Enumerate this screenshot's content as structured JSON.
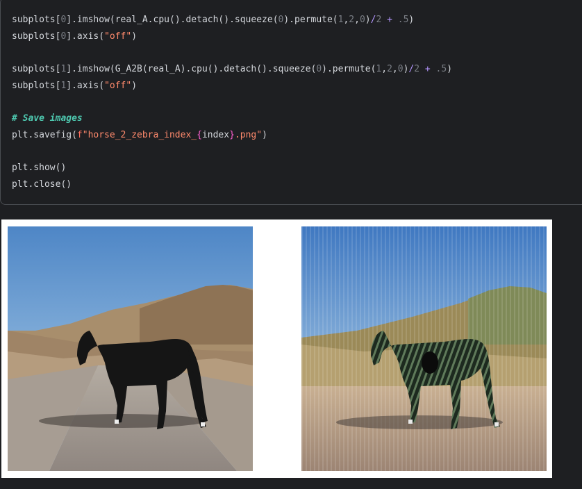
{
  "code": {
    "lines": [
      [
        {
          "t": "subplots[",
          "c": ""
        },
        {
          "t": "0",
          "c": "num"
        },
        {
          "t": "].imshow(real_A.cpu().detach().squeeze(",
          "c": ""
        },
        {
          "t": "0",
          "c": "num"
        },
        {
          "t": ").permute(",
          "c": ""
        },
        {
          "t": "1",
          "c": "num"
        },
        {
          "t": ",",
          "c": ""
        },
        {
          "t": "2",
          "c": "num"
        },
        {
          "t": ",",
          "c": ""
        },
        {
          "t": "0",
          "c": "num"
        },
        {
          "t": ")",
          "c": ""
        },
        {
          "t": "/",
          "c": "op"
        },
        {
          "t": "2",
          "c": "num"
        },
        {
          "t": " ",
          "c": ""
        },
        {
          "t": "+",
          "c": "op"
        },
        {
          "t": " ",
          "c": ""
        },
        {
          "t": ".5",
          "c": "num"
        },
        {
          "t": ")",
          "c": ""
        }
      ],
      [
        {
          "t": "subplots[",
          "c": ""
        },
        {
          "t": "0",
          "c": "num"
        },
        {
          "t": "].axis(",
          "c": ""
        },
        {
          "t": "\"off\"",
          "c": "str"
        },
        {
          "t": ")",
          "c": ""
        }
      ],
      [],
      [
        {
          "t": "subplots[",
          "c": ""
        },
        {
          "t": "1",
          "c": "num"
        },
        {
          "t": "].imshow(G_A2B(real_A).cpu().detach().squeeze(",
          "c": ""
        },
        {
          "t": "0",
          "c": "num"
        },
        {
          "t": ").permute(",
          "c": ""
        },
        {
          "t": "1",
          "c": "num"
        },
        {
          "t": ",",
          "c": ""
        },
        {
          "t": "2",
          "c": "num"
        },
        {
          "t": ",",
          "c": ""
        },
        {
          "t": "0",
          "c": "num"
        },
        {
          "t": ")",
          "c": ""
        },
        {
          "t": "/",
          "c": "op"
        },
        {
          "t": "2",
          "c": "num"
        },
        {
          "t": " ",
          "c": ""
        },
        {
          "t": "+",
          "c": "op"
        },
        {
          "t": " ",
          "c": ""
        },
        {
          "t": ".5",
          "c": "num"
        },
        {
          "t": ")",
          "c": ""
        }
      ],
      [
        {
          "t": "subplots[",
          "c": ""
        },
        {
          "t": "1",
          "c": "num"
        },
        {
          "t": "].axis(",
          "c": ""
        },
        {
          "t": "\"off\"",
          "c": "str"
        },
        {
          "t": ")",
          "c": ""
        }
      ],
      [],
      [
        {
          "t": "# Save images",
          "c": "cm"
        }
      ],
      [
        {
          "t": "plt.savefig(",
          "c": ""
        },
        {
          "t": "f",
          "c": "fpre"
        },
        {
          "t": "\"horse_2_zebra_index_",
          "c": "str"
        },
        {
          "t": "{",
          "c": "brace"
        },
        {
          "t": "index",
          "c": ""
        },
        {
          "t": "}",
          "c": "brace"
        },
        {
          "t": ".png\"",
          "c": "str"
        },
        {
          "t": ")",
          "c": ""
        }
      ],
      [],
      [
        {
          "t": "plt.show()",
          "c": ""
        }
      ],
      [
        {
          "t": "plt.close()",
          "c": ""
        }
      ]
    ]
  },
  "output": {
    "images": [
      {
        "name": "real-horse-image"
      },
      {
        "name": "generated-zebra-image"
      }
    ]
  },
  "colors": {
    "background": "#1e1f22",
    "text": "#d4d7dc",
    "number": "#7a7e85",
    "string": "#ff8a6c",
    "operator": "#b496ff",
    "comment": "#4ec9b0"
  }
}
